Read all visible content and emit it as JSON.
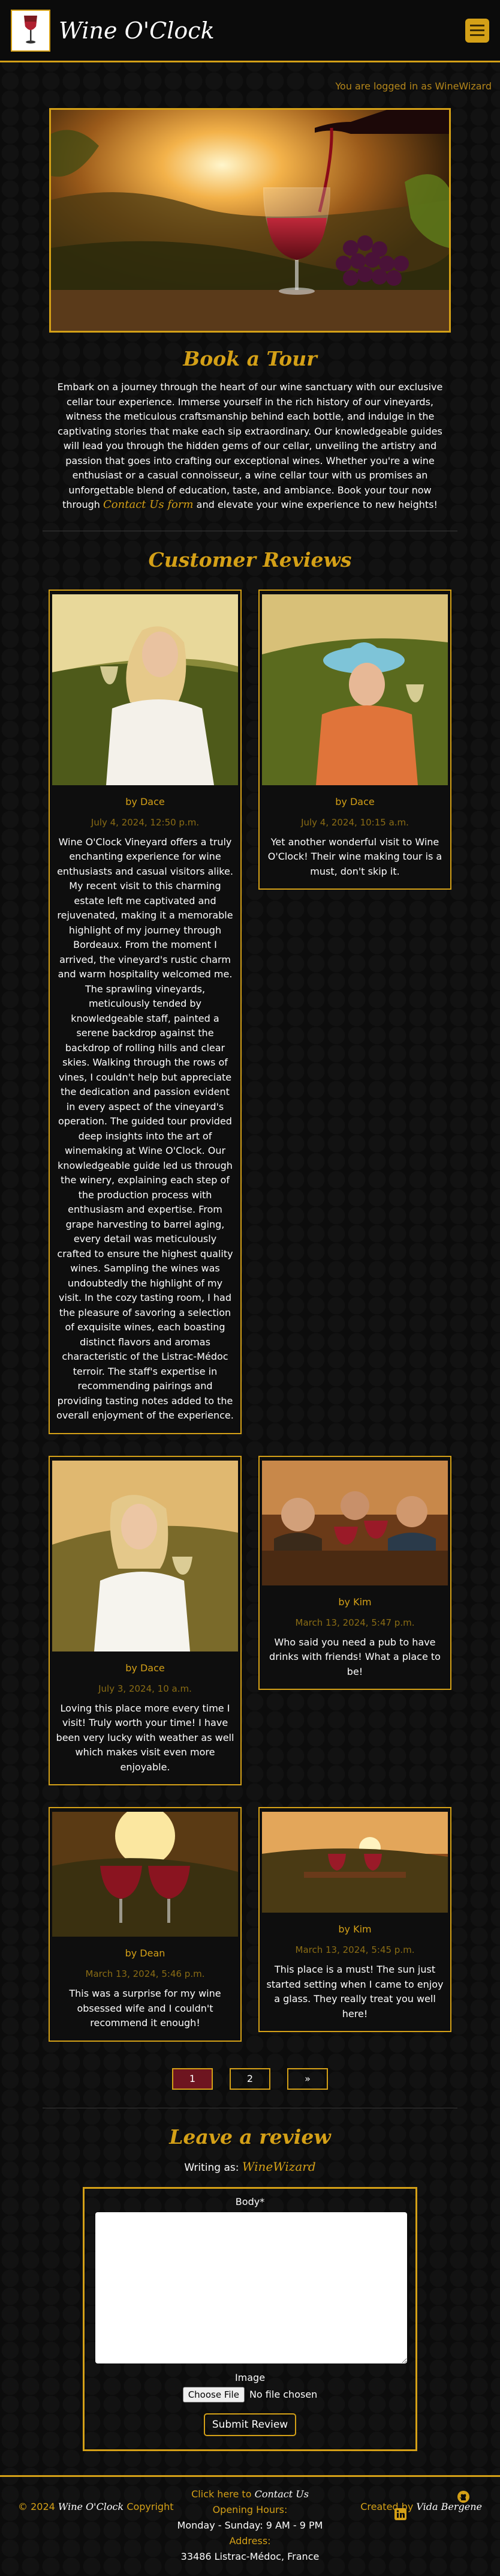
{
  "brand": {
    "name": "Wine O'Clock"
  },
  "session": {
    "logged_in_text": "You are logged in as WineWizard"
  },
  "tour": {
    "title": "Book a Tour",
    "text": "Embark on a journey through the heart of our wine sanctuary with our exclusive cellar tour experience. Immerse yourself in the rich history of our vineyards, witness the meticulous craftsmanship behind each bottle, and indulge in the captivating stories that make each sip extraordinary. Our knowledgeable guides will lead you through the hidden gems of our cellar, unveiling the artistry and passion that goes into crafting our exceptional wines. Whether you're a wine enthusiast or a casual connoisseur, a wine cellar tour with us promises an unforgettable blend of education, taste, and ambiance. Book your tour now through",
    "contact_link": "Contact Us form",
    "text_after": "and elevate your wine experience to new heights!"
  },
  "reviews": {
    "title": "Customer Reviews",
    "items": [
      {
        "author": "by Dace",
        "date": "July 4, 2024, 12:50 p.m.",
        "body": "Wine O'Clock Vineyard offers a truly enchanting experience for wine enthusiasts and casual visitors alike. My recent visit to this charming estate left me captivated and rejuvenated, making it a memorable highlight of my journey through Bordeaux. From the moment I arrived, the vineyard's rustic charm and warm hospitality welcomed me. The sprawling vineyards, meticulously tended by knowledgeable staff, painted a serene backdrop against the backdrop of rolling hills and clear skies. Walking through the rows of vines, I couldn't help but appreciate the dedication and passion evident in every aspect of the vineyard's operation. The guided tour provided deep insights into the art of winemaking at Wine O'Clock. Our knowledgeable guide led us through the winery, explaining each step of the production process with enthusiasm and expertise. From grape harvesting to barrel aging, every detail was meticulously crafted to ensure the highest quality wines. Sampling the wines was undoubtedly the highlight of my visit. In the cozy tasting room, I had the pleasure of savoring a selection of exquisite wines, each boasting distinct flavors and aromas characteristic of the Listrac-Médoc terroir. The staff's expertise in recommending pairings and providing tasting notes added to the overall enjoyment of the experience."
      },
      {
        "author": "by Dace",
        "date": "July 4, 2024, 10:15 a.m.",
        "body": "Yet another wonderful visit to Wine O'Clock! Their wine making tour is a must, don't skip it."
      },
      {
        "author": "by Dace",
        "date": "July 3, 2024, 10 a.m.",
        "body": "Loving this place more every time I visit! Truly worth your time! I have been very lucky with weather as well which makes visit even more enjoyable."
      },
      {
        "author": "by Kim",
        "date": "March 13, 2024, 5:47 p.m.",
        "body": "Who said you need a pub to have drinks with friends! What a place to be!"
      },
      {
        "author": "by Dean",
        "date": "March 13, 2024, 5:46 p.m.",
        "body": "This was a surprise for my wine obsessed wife and I couldn't recommend it enough!"
      },
      {
        "author": "by Kim",
        "date": "March 13, 2024, 5:45 p.m.",
        "body": "This place is a must! The sun just started setting when I came to enjoy a glass. They really treat you well here!"
      }
    ]
  },
  "pagination": {
    "pages": [
      "1",
      "2",
      "»"
    ],
    "current": "1"
  },
  "form": {
    "title": "Leave a review",
    "writing_as_label": "Writing as:",
    "username": "WineWizard",
    "body_label": "Body*",
    "image_label": "Image",
    "choose_file_label": "Choose File",
    "no_file_text": "No file chosen",
    "submit_label": "Submit Review"
  },
  "footer": {
    "copyright_prefix": "© 2024",
    "copyright_brand": "Wine O'Clock",
    "copyright_suffix": "Copyright",
    "click_here": "Click here to",
    "contact_us": "Contact Us",
    "opening_hours_label": "Opening Hours:",
    "opening_hours": "Monday - Sunday: 9 AM - 9 PM",
    "address_label": "Address:",
    "address": "33486 Listrac-Médoc, France",
    "created_by": "Created by",
    "author": "Vida Bergene"
  },
  "colors": {
    "accent": "#d4a017",
    "background": "#0c0c0c",
    "active_page": "#6e1520"
  }
}
